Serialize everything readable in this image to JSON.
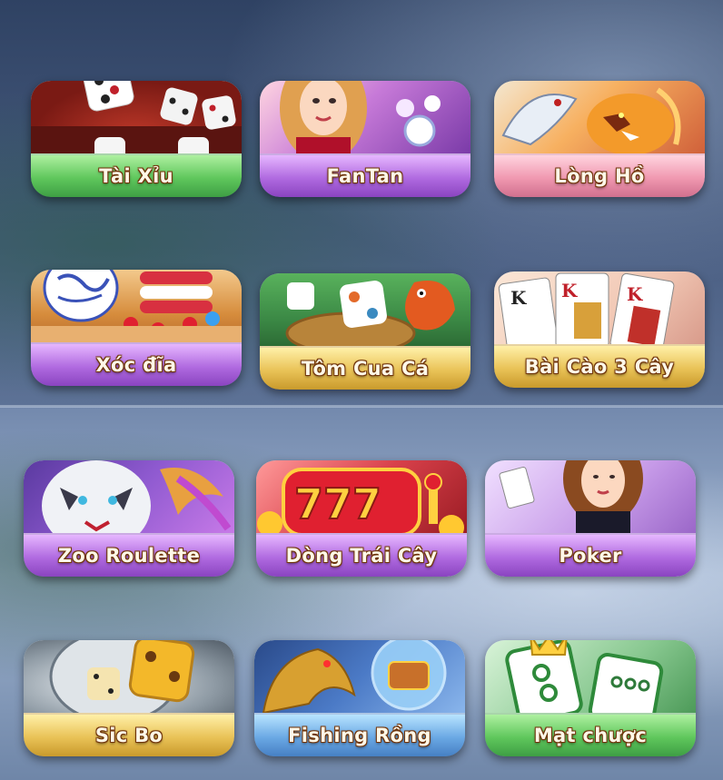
{
  "games": [
    {
      "label": "Tài Xỉu",
      "icon": "dice-icon"
    },
    {
      "label": "FanTan",
      "icon": "dealer-girl-icon"
    },
    {
      "label": "Lòng Hồ",
      "icon": "dragon-tiger-icon"
    },
    {
      "label": "Xóc đĩa",
      "icon": "bowl-chips-icon"
    },
    {
      "label": "Tôm Cua Cá",
      "icon": "shrimp-dice-icon"
    },
    {
      "label": "Bài Cào 3 Cây",
      "icon": "king-cards-icon"
    },
    {
      "label": "Zoo Roulette",
      "icon": "tiger-phoenix-icon"
    },
    {
      "label": "Dòng Trái Cây",
      "icon": "slot-777-icon"
    },
    {
      "label": "Poker",
      "icon": "poker-girl-icon"
    },
    {
      "label": "Sic Bo",
      "icon": "gold-dice-icon"
    },
    {
      "label": "Fishing Rồng",
      "icon": "golden-dragon-icon"
    },
    {
      "label": "Mạt chược",
      "icon": "mahjong-tiles-icon"
    }
  ]
}
